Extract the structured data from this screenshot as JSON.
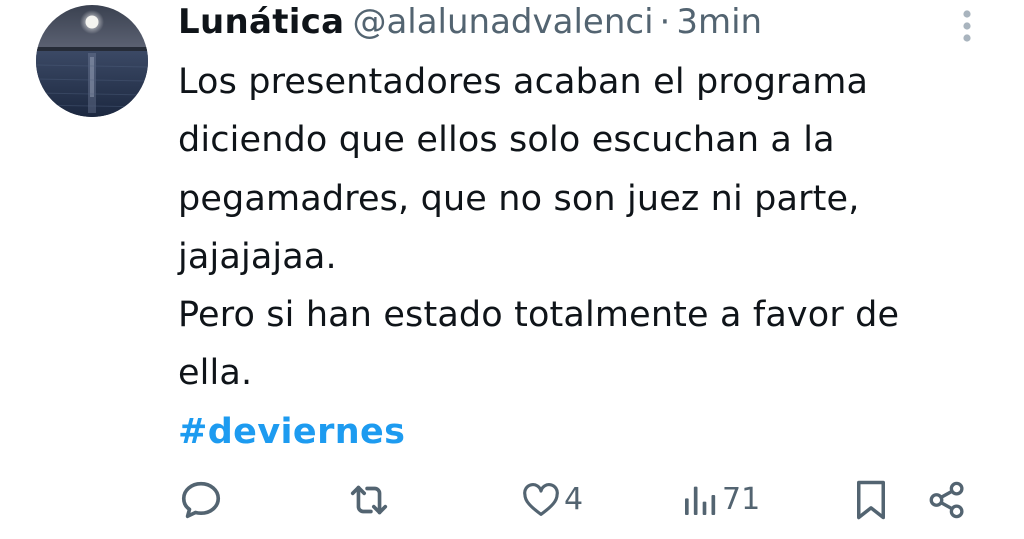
{
  "tweet": {
    "author": {
      "display_name": "Lunática",
      "handle": "@alalunadvalenci",
      "separator": "·",
      "time": "3min",
      "avatar_icon": "moon-over-sea-avatar"
    },
    "text_lines": [
      "Los presentadores acaban el programa",
      "diciendo que ellos solo escuchan a la",
      "pegamadres, que no son juez ni parte,",
      "jajajajaa.",
      "Pero si han estado totalmente a favor de",
      "ella."
    ],
    "hashtag": "#deviernes"
  },
  "actions": {
    "reply": {
      "icon": "reply-icon",
      "count": ""
    },
    "retweet": {
      "icon": "retweet-icon",
      "count": ""
    },
    "like": {
      "icon": "heart-icon",
      "count": "4"
    },
    "views": {
      "icon": "views-icon",
      "count": "71"
    },
    "bookmark": {
      "icon": "bookmark-icon"
    },
    "share": {
      "icon": "share-icon"
    }
  },
  "colors": {
    "text": "#0f1419",
    "secondary": "#536471",
    "link": "#1d9bf0",
    "background": "#ffffff"
  }
}
